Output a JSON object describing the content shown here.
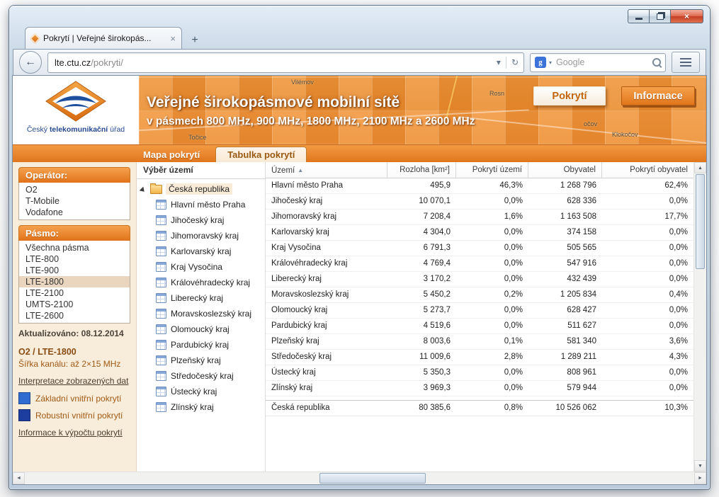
{
  "window": {
    "close_glyph": "×"
  },
  "browser": {
    "tab_title": "Pokrytí | Veřejné širokopás...",
    "tab_close_glyph": "×",
    "new_tab_glyph": "+",
    "back_glyph": "←",
    "url": {
      "domain": "lte.ctu.cz",
      "path": "/pokryti/"
    },
    "url_dropdown_glyph": "▾",
    "reload_glyph": "↻",
    "search": {
      "placeholder": "Google",
      "engine_glyph": "g",
      "dropdown_glyph": "▾"
    }
  },
  "site_header": {
    "logo_caption_pre": "Český ",
    "logo_caption_bold": "telekomunikační",
    "logo_caption_post": " úřad",
    "title": "Veřejné širokopásmové mobilní sítě",
    "subtitle": "v pásmech 800 MHz, 900 MHz, 1800 MHz, 2100 MHz a 2600 MHz",
    "button_pokryti": "Pokrytí",
    "button_informace": "Informace",
    "map_labels": [
      "Vilémov",
      "Rosn",
      "Točice",
      "Klokočov",
      "očov"
    ]
  },
  "page_tabs": {
    "map": "Mapa pokrytí",
    "table": "Tabulka pokrytí"
  },
  "sidebar": {
    "operator": {
      "title": "Operátor:",
      "items": [
        "O2",
        "T-Mobile",
        "Vodafone"
      ]
    },
    "band": {
      "title": "Pásmo:",
      "items": [
        "Všechna pásma",
        "LTE-800",
        "LTE-900",
        "LTE-1800",
        "LTE-2100",
        "UMTS-2100",
        "LTE-2600"
      ],
      "selected": "LTE-1800"
    },
    "updated": "Aktualizováno: 08.12.2014",
    "selection_title": "O2 / LTE-1800",
    "channel_width": "Šířka kanálu: až 2×15 MHz",
    "link_interpretation": "Interpretace zobrazených dat",
    "legend": [
      {
        "label": "Základní vnitřní pokrytí",
        "color": "#2f6bd1"
      },
      {
        "label": "Robustní vnitřní pokrytí",
        "color": "#1d3e9e"
      }
    ],
    "link_calculation": "Informace k výpočtu pokrytí"
  },
  "tree": {
    "title": "Výběr území",
    "root": "Česká republika",
    "children": [
      "Hlavní město Praha",
      "Jihočeský kraj",
      "Jihomoravský kraj",
      "Karlovarský kraj",
      "Kraj Vysočina",
      "Královéhradecký kraj",
      "Liberecký kraj",
      "Moravskoslezský kraj",
      "Olomoucký kraj",
      "Pardubický kraj",
      "Plzeňský kraj",
      "Středočeský kraj",
      "Ústecký kraj",
      "Zlínský kraj"
    ]
  },
  "table": {
    "columns": [
      "Území",
      "Rozloha [km²]",
      "Pokrytí území",
      "Obyvatel",
      "Pokrytí obyvatel"
    ],
    "sort_glyph": "▲",
    "rows": [
      {
        "name": "Hlavní město Praha",
        "area": "495,9",
        "coverage_area": "46,3%",
        "population": "1 268 796",
        "coverage_population": "62,4%"
      },
      {
        "name": "Jihočeský kraj",
        "area": "10 070,1",
        "coverage_area": "0,0%",
        "population": "628 336",
        "coverage_population": "0,0%"
      },
      {
        "name": "Jihomoravský kraj",
        "area": "7 208,4",
        "coverage_area": "1,6%",
        "population": "1 163 508",
        "coverage_population": "17,7%"
      },
      {
        "name": "Karlovarský kraj",
        "area": "4 304,0",
        "coverage_area": "0,0%",
        "population": "374 158",
        "coverage_population": "0,0%"
      },
      {
        "name": "Kraj Vysočina",
        "area": "6 791,3",
        "coverage_area": "0,0%",
        "population": "505 565",
        "coverage_population": "0,0%"
      },
      {
        "name": "Královéhradecký kraj",
        "area": "4 769,4",
        "coverage_area": "0,0%",
        "population": "547 916",
        "coverage_population": "0,0%"
      },
      {
        "name": "Liberecký kraj",
        "area": "3 170,2",
        "coverage_area": "0,0%",
        "population": "432 439",
        "coverage_population": "0,0%"
      },
      {
        "name": "Moravskoslezský kraj",
        "area": "5 450,2",
        "coverage_area": "0,2%",
        "population": "1 205 834",
        "coverage_population": "0,4%"
      },
      {
        "name": "Olomoucký kraj",
        "area": "5 273,7",
        "coverage_area": "0,0%",
        "population": "628 427",
        "coverage_population": "0,0%"
      },
      {
        "name": "Pardubický kraj",
        "area": "4 519,6",
        "coverage_area": "0,0%",
        "population": "511 627",
        "coverage_population": "0,0%"
      },
      {
        "name": "Plzeňský kraj",
        "area": "8 003,6",
        "coverage_area": "0,1%",
        "population": "581 340",
        "coverage_population": "3,6%"
      },
      {
        "name": "Středočeský kraj",
        "area": "11 009,6",
        "coverage_area": "2,8%",
        "population": "1 289 211",
        "coverage_population": "4,3%"
      },
      {
        "name": "Ústecký kraj",
        "area": "5 350,3",
        "coverage_area": "0,0%",
        "population": "808 961",
        "coverage_population": "0,0%"
      },
      {
        "name": "Zlínský kraj",
        "area": "3 969,3",
        "coverage_area": "0,0%",
        "population": "579 944",
        "coverage_population": "0,0%"
      }
    ],
    "summary": {
      "name": "Česká republika",
      "area": "80 385,6",
      "coverage_area": "0,8%",
      "population": "10 526 062",
      "coverage_population": "10,3%"
    }
  },
  "scroll": {
    "up": "▲",
    "down": "▼",
    "left": "◄",
    "right": "►"
  }
}
